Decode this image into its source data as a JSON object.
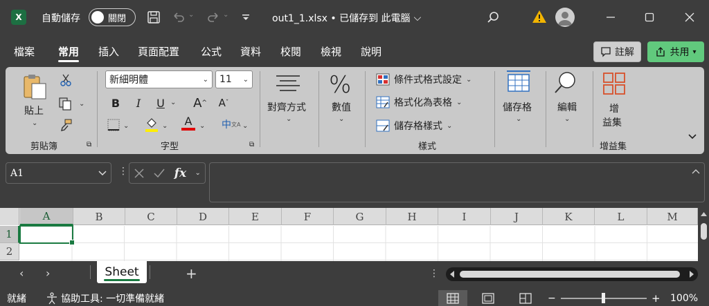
{
  "titlebar": {
    "app_logo": "X",
    "autosave_label": "自動儲存",
    "autosave_state": "關閉",
    "filename": "out1_1.xlsx • 已儲存到 此電腦",
    "icons": [
      "save-icon",
      "undo-icon",
      "redo-icon",
      "customize-icon",
      "search-icon",
      "warning-icon",
      "avatar-icon",
      "minimize-icon",
      "maximize-icon",
      "close-icon"
    ]
  },
  "tabs": [
    {
      "label": "檔案"
    },
    {
      "label": "常用",
      "active": true
    },
    {
      "label": "插入"
    },
    {
      "label": "頁面配置"
    },
    {
      "label": "公式"
    },
    {
      "label": "資料"
    },
    {
      "label": "校閱"
    },
    {
      "label": "檢視"
    },
    {
      "label": "說明"
    }
  ],
  "comments_label": "註解",
  "share_label": "共用",
  "ribbon": {
    "paste_label": "貼上",
    "clipboard_group": "剪貼簿",
    "font_name": "新細明體",
    "font_size": "11",
    "bold": "B",
    "italic": "I",
    "underline": "U",
    "grow_font": "A",
    "shrink_font": "A",
    "font_color_letter": "A",
    "phonetic": "中",
    "font_group": "字型",
    "alignment_label": "對齊方式",
    "number_label": "數值",
    "number_symbol": "%",
    "conditional_format": "條件式格式設定",
    "format_as_table": "格式化為表格",
    "cell_styles": "儲存格樣式",
    "styles_group": "樣式",
    "cells_label": "儲存格",
    "editing_label": "編輯",
    "addins_label_1": "增",
    "addins_label_2": "益集",
    "addins_group": "增益集"
  },
  "formula_bar": {
    "name_box": "A1",
    "fx": "fx",
    "formula": ""
  },
  "grid": {
    "columns": [
      "A",
      "B",
      "C",
      "D",
      "E",
      "F",
      "G",
      "H",
      "I",
      "J",
      "K",
      "L",
      "M"
    ],
    "rows": [
      "1",
      "2"
    ],
    "selected_cell": "A1"
  },
  "sheets": {
    "tabs": [
      "Sheet"
    ],
    "add": "+"
  },
  "statusbar": {
    "ready": "就緒",
    "accessibility": "協助工具: 一切準備就緒",
    "zoom_minus": "−",
    "zoom_plus": "+",
    "zoom": "100%",
    "zoom_level_percent": 100
  },
  "colors": {
    "excel_green": "#1d6f42",
    "share_green": "#61c97d",
    "selection_green": "#1a7a41",
    "ribbon_bg": "#c9c9c9",
    "window_bg": "#3d3d3d"
  }
}
